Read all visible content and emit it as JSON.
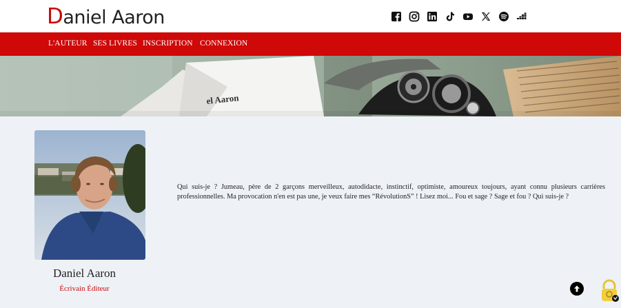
{
  "header": {
    "logo_text_first": "D",
    "logo_text_rest": "aniel Aaron",
    "social_icons": [
      "facebook-icon",
      "instagram-icon",
      "linkedin-icon",
      "tiktok-icon",
      "youtube-icon",
      "x-icon",
      "spotify-icon",
      "deezer-icon"
    ]
  },
  "nav": {
    "items": [
      "L'AUTEUR",
      "SES LIVRES",
      "INSCRIPTION",
      "CONNEXION"
    ]
  },
  "hero": {
    "envelope_text": "el Aaron"
  },
  "profile": {
    "name": "Daniel Aaron",
    "role": "Écrivain Éditeur",
    "bio": "Qui suis-je ? Jumeau, père de 2 garçons merveilleux, autodidacte, instinctif, optimiste, amoureux toujours, ayant connu plusieurs carrières professionnelles. Ma provocation n'en est pas une, je veux faire mes “RévolutionS” ! Lisez moi... Fou et sage ? Sage et fou ? Qui suis-je ?"
  },
  "colors": {
    "brand_red": "#cf0808",
    "accent_red_text": "#c80a0a",
    "background": "#eef2f6"
  }
}
